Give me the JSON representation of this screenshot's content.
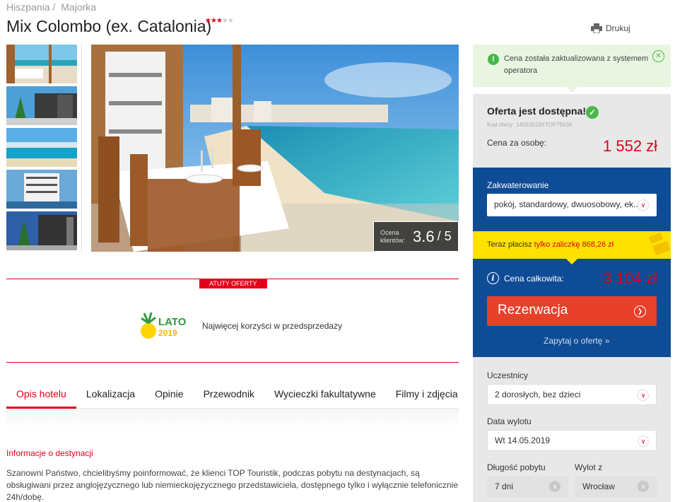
{
  "breadcrumb": {
    "country": "Hiszpania",
    "separator": "/",
    "region": "Majorka"
  },
  "hotel": {
    "name": "Mix Colombo (ex. Catalonia)",
    "stars_filled": 3,
    "stars_total": 5
  },
  "print_label": "Drukuj",
  "rating": {
    "label": "Ocena klientów:",
    "value": "3.6",
    "max": "/ 5"
  },
  "atuty": {
    "badge": "ATUTY OFERTY",
    "logo_text": "LATO",
    "logo_year": "2019",
    "text": "Najwięcej korzyści w przedsprzedaży"
  },
  "tabs": [
    "Opis hotelu",
    "Lokalizacja",
    "Opinie",
    "Przewodnik",
    "Wycieczki fakultatywne",
    "Filmy i zdjęcia"
  ],
  "info": {
    "heading": "Informacje o destynacji",
    "text": "Szanowni Państwo, chcielibyśmy poinformować, że klienci TOP Touristik, podczas pobytu na destynacjach, są obsługiwani przez anglojęzycznego lub niemieckojęzycznego przedstawiciela, dostępnego tylko i wyłącznie telefonicznie 24h/dobę."
  },
  "notice": {
    "text": "Cena została zaktualizowana z systemem operatora"
  },
  "offer": {
    "status": "Oferta jest dostępna!",
    "code": "Kod oferty: 14052019XTOP79436",
    "per_person_label": "Cena za osobę:",
    "per_person_price": "1 552 zł"
  },
  "accommodation": {
    "label": "Zakwaterowanie",
    "value": "pokój, standardowy, dwuosobowy, ek..."
  },
  "deposit": {
    "prefix": "Teraz płacisz",
    "highlight": "tylko zaliczkę 868,26 zł"
  },
  "total": {
    "label": "Cena całkowita:",
    "price": "3 104 zł"
  },
  "reserve_label": "Rezerwacja",
  "ask_label": "Zapytaj o ofertę »",
  "form": {
    "participants_label": "Uczestnicy",
    "participants_value": "2 dorosłych, bez dzieci",
    "date_label": "Data wylotu",
    "date_value": "Wt 14.05.2019",
    "length_label": "Długość pobytu",
    "length_value": "7 dni",
    "from_label": "Wylot z",
    "from_value": "Wrocław"
  },
  "colors": {
    "brand_red": "#e2001a",
    "blue": "#0f4c96",
    "yellow": "#ffe100",
    "green": "#47b847"
  }
}
